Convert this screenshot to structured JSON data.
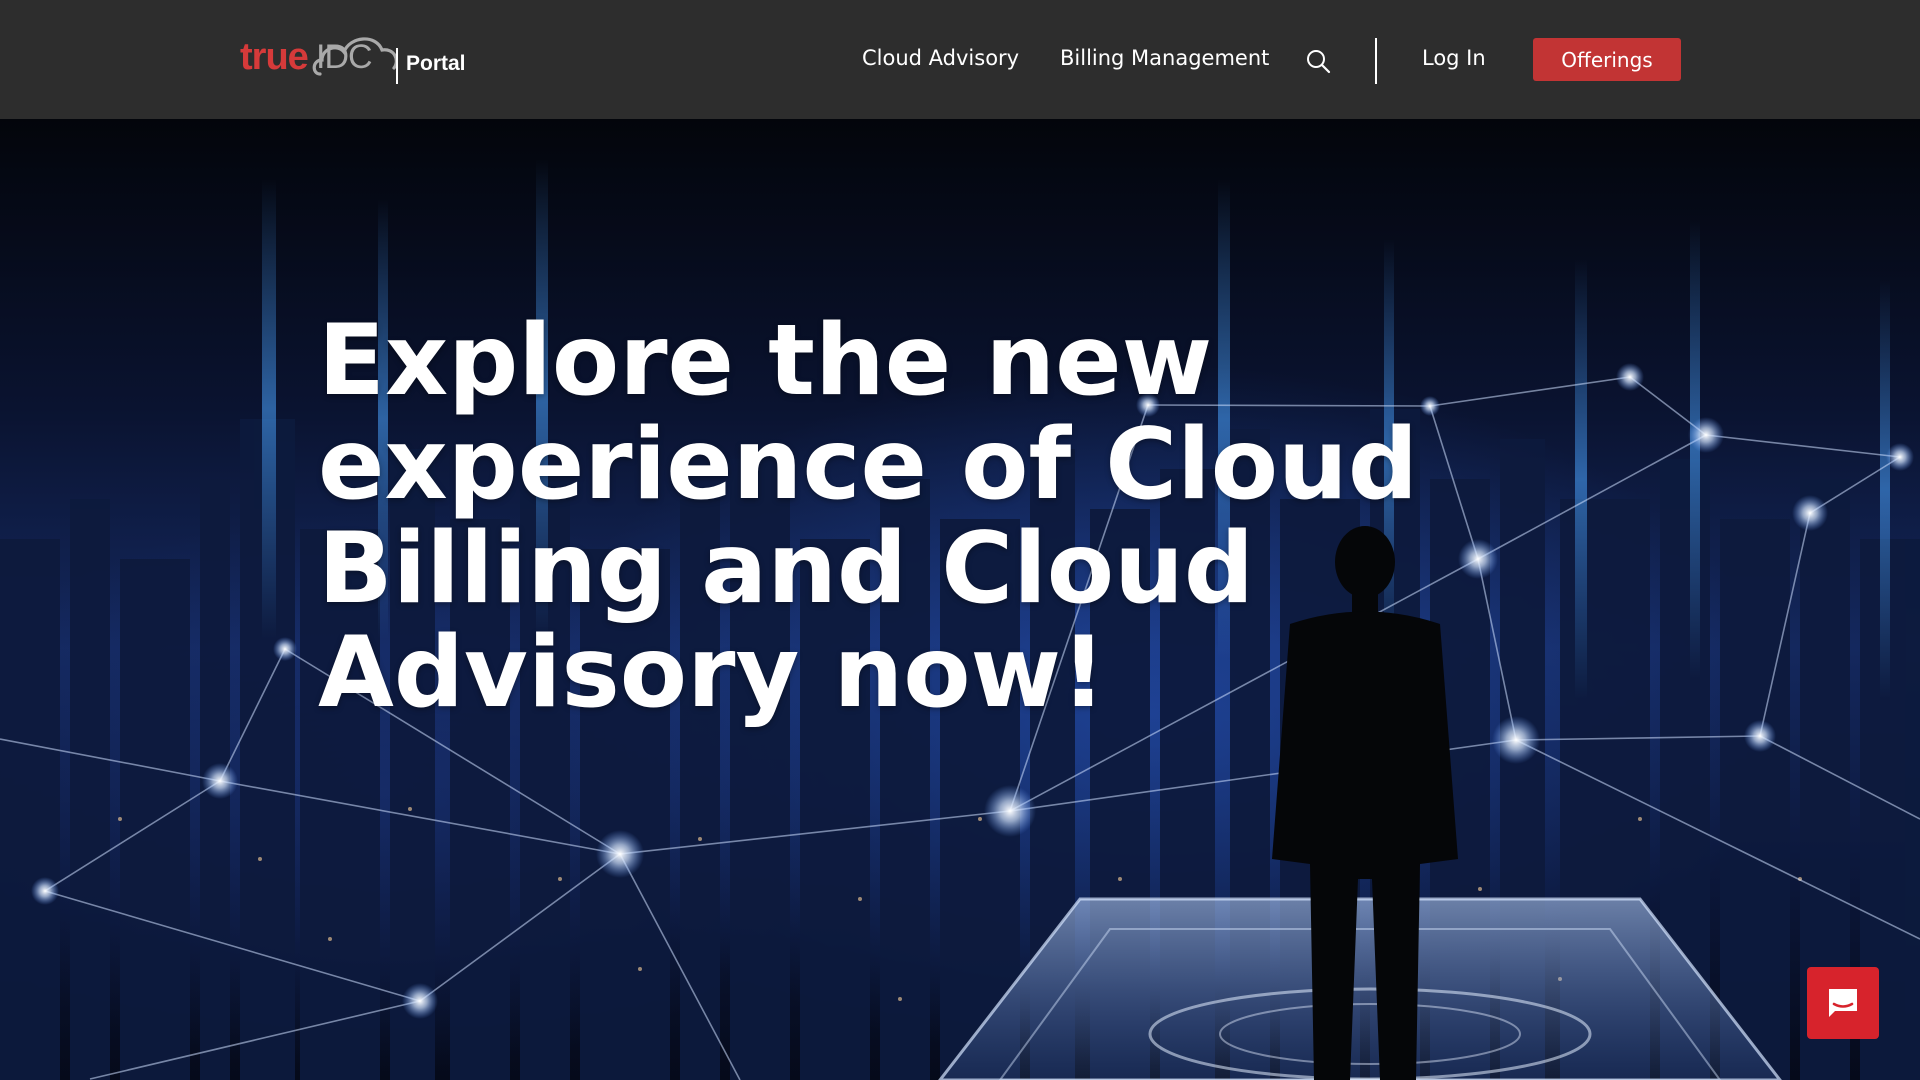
{
  "header": {
    "logo": {
      "brand_true": "true",
      "brand_idc": "IDC",
      "product": "Portal"
    },
    "nav": {
      "cloud_advisory": "Cloud Advisory",
      "billing_management": "Billing Management",
      "search_icon": "search-icon",
      "login": "Log In",
      "offerings": "Offerings"
    }
  },
  "hero": {
    "title": "Explore the new experience of Cloud Billing and Cloud Advisory now!"
  },
  "chat": {
    "icon": "chat-icon"
  },
  "colors": {
    "header_bg": "#2d2d2d",
    "brand_red": "#c23434",
    "chat_red": "#d7232c",
    "text": "#ffffff"
  }
}
